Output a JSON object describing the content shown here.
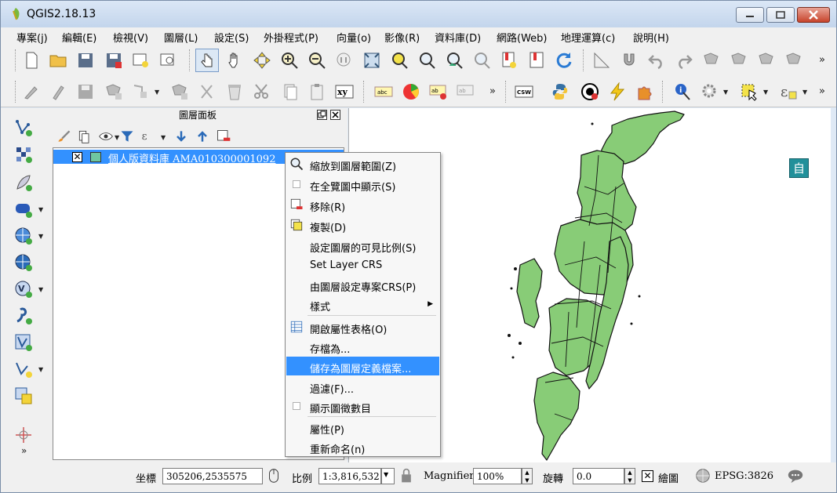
{
  "window": {
    "title": "QGIS2.18.13"
  },
  "menu": [
    "專案(j)",
    "編輯(E)",
    "檢視(V)",
    "圖層(L)",
    "設定(S)",
    "外掛程式(P)",
    "向量(o)",
    "影像(R)",
    "資料庫(D)",
    "網路(Web)",
    "地理運算(c)",
    "說明(H)"
  ],
  "panel": {
    "title": "圖層面板",
    "layer_name": "個人版資料庫 AMA010300001092"
  },
  "context_menu": [
    {
      "label": "縮放到圖層範圍(Z)",
      "icon": "zoom-layer-icon"
    },
    {
      "label": "在全覽圖中顯示(S)",
      "icon": "checkbox-icon"
    },
    {
      "label": "移除(R)",
      "icon": "remove-layer-icon"
    },
    {
      "label": "複製(D)",
      "icon": "duplicate-icon"
    },
    {
      "label": "設定圖層的可見比例(S)",
      "icon": ""
    },
    {
      "label": "Set Layer CRS",
      "icon": ""
    },
    {
      "label": "由圖層設定專案CRS(P)",
      "icon": ""
    },
    {
      "label": "樣式",
      "icon": "",
      "submenu": true
    },
    {
      "label": "開啟屬性表格(O)",
      "icon": "table-icon"
    },
    {
      "label": "存檔為...",
      "icon": ""
    },
    {
      "label": "儲存為圖層定義檔案...",
      "icon": "",
      "highlighted": true
    },
    {
      "label": "過濾(F)...",
      "icon": ""
    },
    {
      "label": "顯示圖徵數目",
      "icon": "checkbox-icon"
    },
    {
      "label": "屬性(P)",
      "icon": ""
    },
    {
      "label": "重新命名(n)",
      "icon": ""
    }
  ],
  "render_badge": "自",
  "status": {
    "coord_label": "坐標",
    "coord_value": "305206,2535575",
    "scale_label": "比例",
    "scale_value": "1:3,816,532",
    "magnifier_label": "Magnifier",
    "magnifier_value": "100%",
    "rotation_label": "旋轉",
    "rotation_value": "0.0",
    "render_label": "繪圖",
    "crs": "EPSG:3826"
  },
  "colors": {
    "layer_fill": "#88cc77",
    "highlight": "#3391ff"
  }
}
